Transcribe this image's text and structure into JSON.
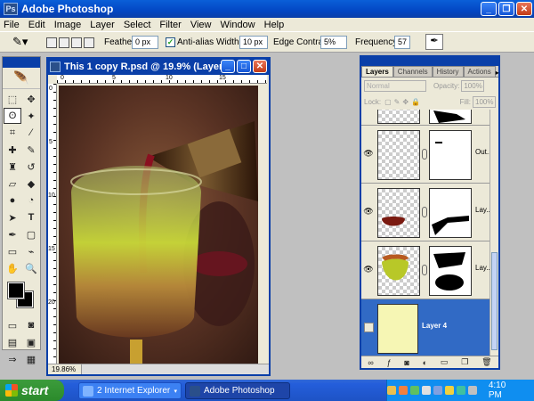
{
  "app": {
    "title": "Adobe Photoshop"
  },
  "menu": [
    "File",
    "Edit",
    "Image",
    "Layer",
    "Select",
    "Filter",
    "View",
    "Window",
    "Help"
  ],
  "options": {
    "feather_label": "Feather:",
    "feather_value": "0 px",
    "antialias_label": "Anti-alias",
    "antialias_checked": true,
    "width_label": "Width:",
    "width_value": "10 px",
    "edge_label": "Edge Contrast:",
    "edge_value": "5%",
    "freq_label": "Frequency:",
    "freq_value": "57"
  },
  "document": {
    "title": "This 1 copy R.psd @ 19.9% (Layer ...",
    "zoom_status": "19.86%",
    "ruler_top": [
      "0",
      "5",
      "10",
      "15"
    ],
    "ruler_left": [
      "0",
      "5",
      "10",
      "15",
      "20"
    ]
  },
  "layers_panel": {
    "tabs": [
      "Layers",
      "Channels",
      "History",
      "Actions"
    ],
    "blend_mode": "Normal",
    "opacity_label": "Opacity:",
    "opacity_value": "100%",
    "lock_label": "Lock:",
    "fill_label": "Fill:",
    "fill_value": "100%",
    "layers": [
      {
        "name": "",
        "visible": true
      },
      {
        "name": "Out...",
        "visible": true
      },
      {
        "name": "Lay...",
        "visible": true
      },
      {
        "name": "Lay...",
        "visible": true
      },
      {
        "name": "Layer 4",
        "visible": false,
        "selected": true
      }
    ]
  },
  "taskbar": {
    "start_label": "start",
    "tasks": [
      "2 Internet Explorer",
      "Adobe Photoshop"
    ],
    "clock": "4:10 PM"
  },
  "colors": {
    "titlebar": "#0347c4",
    "selected_layer": "#316ac5",
    "layer4_fill": "#f6f6b4"
  }
}
